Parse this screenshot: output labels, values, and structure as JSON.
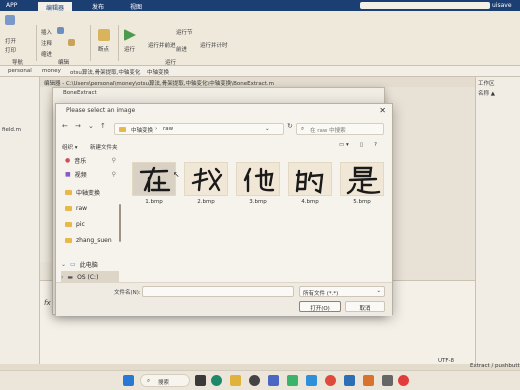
{
  "matlab": {
    "tabs": [
      "APP",
      "编辑器",
      "发布",
      "视图"
    ],
    "user": "uisave",
    "ribbon": {
      "open_compare": "打开",
      "print": "打印",
      "navigate_label": "导航",
      "insert": "插入",
      "comment": "注释",
      "indent": "缩进",
      "edit_label": "编辑",
      "breakpoints": "断点",
      "run": "运行",
      "run_advance": "运行并前进",
      "run_section": "运行节",
      "advance": "前进",
      "run_time": "运行并计时",
      "run_label": "运行"
    },
    "path_crumbs": [
      "personal",
      "money",
      "otsu算法,骨架提取,中轴变化",
      "中轴变换"
    ],
    "editor_tab": "编辑器 - C:\\Users\\personal\\money\\otsu算法,骨架提取,中轴变化\\中轴变换\\BoneExtract.m",
    "left_file": "field.m",
    "right_panel_title": "工作区",
    "right_col": "名称 ▲",
    "status_right": "UTF-8",
    "status_right2": "Extract / pushbutt"
  },
  "bone_window": {
    "title": "BoneExtract"
  },
  "dialog": {
    "title": "Please select an image",
    "close": "✕",
    "address_crumbs": [
      "中轴变换",
      "raw"
    ],
    "search_placeholder": "在 raw 中搜索",
    "organize": "组织 ▾",
    "new_folder": "新建文件夹",
    "sidebar": [
      {
        "label": "音乐",
        "icon": "music-icon",
        "pinned": true
      },
      {
        "label": "视频",
        "icon": "video-icon",
        "pinned": true
      },
      {
        "label": "中轴变换",
        "icon": "folder-icon",
        "pinned": false
      },
      {
        "label": "raw",
        "icon": "folder-icon",
        "pinned": false
      },
      {
        "label": "pic",
        "icon": "folder-icon",
        "pinned": false
      },
      {
        "label": "zhang_suen",
        "icon": "folder-icon",
        "pinned": false
      },
      {
        "label": "此电脑",
        "icon": "computer-icon",
        "pinned": false
      },
      {
        "label": "OS (C:)",
        "icon": "drive-icon",
        "pinned": false
      }
    ],
    "files": [
      {
        "name": "1.bmp",
        "char": "在",
        "selected": true
      },
      {
        "name": "2.bmp",
        "char": "我",
        "selected": false
      },
      {
        "name": "3.bmp",
        "char": "他",
        "selected": false
      },
      {
        "name": "4.bmp",
        "char": "的",
        "selected": false
      },
      {
        "name": "5.bmp",
        "char": "是",
        "selected": false
      }
    ],
    "filename_label": "文件名(N):",
    "filename_value": "",
    "filter_value": "所有文件 (*.*)",
    "open_button": "打开(O)",
    "cancel_button": "取消"
  },
  "taskbar": {
    "search": "搜索"
  }
}
